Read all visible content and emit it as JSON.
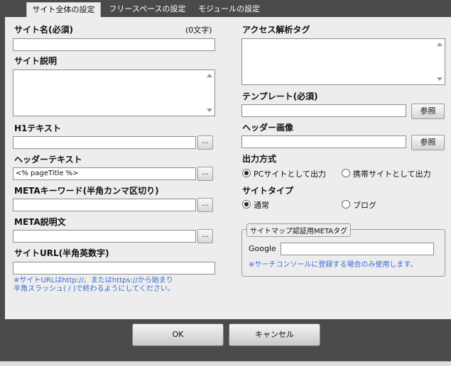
{
  "tabs": [
    {
      "label": "サイト全体の設定"
    },
    {
      "label": "フリースペースの設定"
    },
    {
      "label": "モジュールの設定"
    }
  ],
  "left": {
    "site_name": {
      "label": "サイト名(必須)",
      "counter": "(0文字)",
      "value": ""
    },
    "site_desc": {
      "label": "サイト説明",
      "value": ""
    },
    "h1_text": {
      "label": "H1テキスト",
      "value": ""
    },
    "header_text": {
      "label": "ヘッダーテキスト",
      "value": "<% pageTitle %>"
    },
    "meta_keywords": {
      "label": "METAキーワード(半角カンマ区切り)",
      "value": ""
    },
    "meta_desc": {
      "label": "META説明文",
      "value": ""
    },
    "site_url": {
      "label": "サイトURL(半角英数字)",
      "value": "",
      "note_line1": "※サイトURLはhttp://、またはhttps://から始まり",
      "note_line2": "半角スラッシュ( / )で終わるようにしてください。"
    },
    "browse_label": "..."
  },
  "right": {
    "access_tag": {
      "label": "アクセス解析タグ",
      "value": ""
    },
    "template": {
      "label": "テンプレート(必須)",
      "value": "",
      "button": "参照"
    },
    "header_image": {
      "label": "ヘッダー画像",
      "value": "",
      "button": "参照"
    },
    "output_mode": {
      "label": "出力方式",
      "options": [
        "PCサイトとして出力",
        "携帯サイトとして出力"
      ],
      "selected": "PCサイトとして出力"
    },
    "site_type": {
      "label": "サイトタイプ",
      "options": [
        "通常",
        "ブログ"
      ],
      "selected": "通常"
    },
    "sitemap": {
      "legend": "サイトマップ認証用METAタグ",
      "google_label": "Google",
      "google_value": "",
      "note": "※サーチコンソールに登録する場合のみ使用します。"
    }
  },
  "footer": {
    "ok": "OK",
    "cancel": "キャンセル"
  }
}
